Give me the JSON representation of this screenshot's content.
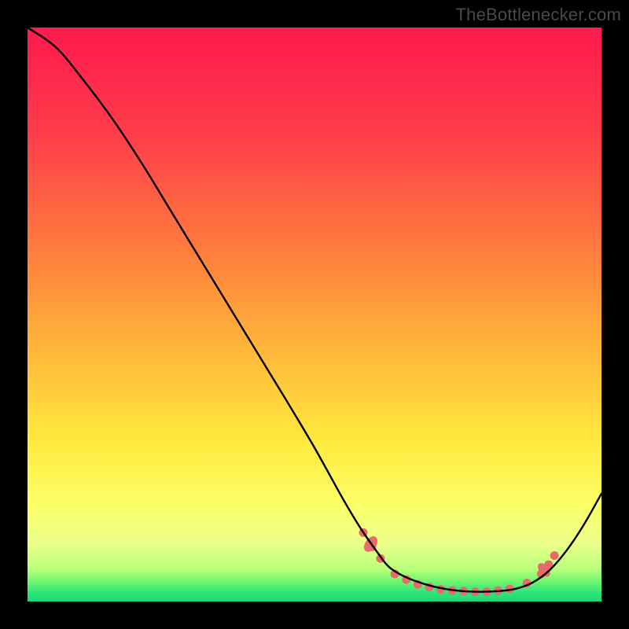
{
  "watermark": "TheBottlenecker.com",
  "gradient_stops": [
    {
      "offset": 0.0,
      "color": "#ff1a4d"
    },
    {
      "offset": 0.18,
      "color": "#ff3b4a"
    },
    {
      "offset": 0.38,
      "color": "#ff7a3e"
    },
    {
      "offset": 0.55,
      "color": "#ffb33a"
    },
    {
      "offset": 0.72,
      "color": "#ffe93e"
    },
    {
      "offset": 0.83,
      "color": "#fbff66"
    },
    {
      "offset": 0.9,
      "color": "#eaff8a"
    },
    {
      "offset": 0.945,
      "color": "#b6ff7a"
    },
    {
      "offset": 0.965,
      "color": "#70f56e"
    },
    {
      "offset": 0.985,
      "color": "#2de57a"
    },
    {
      "offset": 1.0,
      "color": "#1fd97a"
    }
  ],
  "chart_data": {
    "type": "line",
    "title": "",
    "xlabel": "",
    "ylabel": "",
    "xlim": [
      0,
      1
    ],
    "ylim": [
      0,
      1
    ],
    "note": "x normalized 0..1 left→right; y = bottleneck/deviation metric, 0 at bottom (optimal / green) and 1 at top (worst / red). Curve drops from top-left, reaches flat minimum around x≈0.63–0.85, then rises toward the right edge.",
    "series": [
      {
        "name": "bottleneck-curve",
        "x": [
          0.0,
          0.05,
          0.1,
          0.15,
          0.2,
          0.25,
          0.3,
          0.35,
          0.4,
          0.45,
          0.5,
          0.55,
          0.58,
          0.61,
          0.63,
          0.66,
          0.7,
          0.74,
          0.78,
          0.82,
          0.85,
          0.88,
          0.91,
          0.94,
          0.97,
          1.0
        ],
        "y": [
          1.0,
          0.965,
          0.905,
          0.838,
          0.762,
          0.68,
          0.598,
          0.516,
          0.434,
          0.352,
          0.268,
          0.178,
          0.128,
          0.085,
          0.06,
          0.042,
          0.028,
          0.02,
          0.017,
          0.018,
          0.022,
          0.033,
          0.055,
          0.09,
          0.135,
          0.188
        ]
      }
    ],
    "markers": {
      "name": "highlight-dots",
      "color": "#e86a6a",
      "points": [
        {
          "x": 0.585,
          "y": 0.12
        },
        {
          "x": 0.6,
          "y": 0.095
        },
        {
          "x": 0.615,
          "y": 0.075
        },
        {
          "x": 0.64,
          "y": 0.048
        },
        {
          "x": 0.66,
          "y": 0.038
        },
        {
          "x": 0.68,
          "y": 0.03
        },
        {
          "x": 0.7,
          "y": 0.025
        },
        {
          "x": 0.72,
          "y": 0.021
        },
        {
          "x": 0.74,
          "y": 0.019
        },
        {
          "x": 0.76,
          "y": 0.018
        },
        {
          "x": 0.78,
          "y": 0.017
        },
        {
          "x": 0.8,
          "y": 0.017
        },
        {
          "x": 0.82,
          "y": 0.019
        },
        {
          "x": 0.84,
          "y": 0.022
        },
        {
          "x": 0.87,
          "y": 0.032
        },
        {
          "x": 0.895,
          "y": 0.048
        },
        {
          "x": 0.908,
          "y": 0.064
        },
        {
          "x": 0.918,
          "y": 0.08
        }
      ],
      "big_points": [
        {
          "x": 0.598,
          "y": 0.1,
          "rx": 11,
          "ry": 7,
          "rot": -55
        },
        {
          "x": 0.9,
          "y": 0.055,
          "rx": 10,
          "ry": 6,
          "rot": 50
        }
      ]
    }
  }
}
